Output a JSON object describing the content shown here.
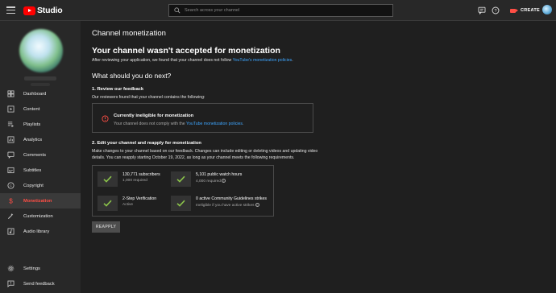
{
  "topbar": {
    "logo_text": "Studio",
    "search_placeholder": "Search across your channel",
    "create_label": "CREATE",
    "icons": [
      "menu-icon",
      "search-icon",
      "message-icon",
      "help-icon",
      "create-camera-icon"
    ]
  },
  "sidebar": {
    "items": [
      {
        "label": "Dashboard",
        "icon": "dashboard-icon"
      },
      {
        "label": "Content",
        "icon": "content-icon"
      },
      {
        "label": "Playlists",
        "icon": "playlists-icon"
      },
      {
        "label": "Analytics",
        "icon": "analytics-icon"
      },
      {
        "label": "Comments",
        "icon": "comments-icon"
      },
      {
        "label": "Subtitles",
        "icon": "subtitles-icon"
      },
      {
        "label": "Copyright",
        "icon": "copyright-icon"
      },
      {
        "label": "Monetization",
        "icon": "monetization-icon"
      },
      {
        "label": "Customization",
        "icon": "customization-icon"
      },
      {
        "label": "Audio library",
        "icon": "audio-library-icon"
      }
    ],
    "bottom_items": [
      {
        "label": "Settings",
        "icon": "settings-icon"
      },
      {
        "label": "Send feedback",
        "icon": "feedback-icon"
      }
    ],
    "active": "Monetization"
  },
  "main": {
    "page_title": "Channel monetization",
    "heading": "Your channel wasn't accepted for monetization",
    "intro_text": "After reviewing your application, we found that your channel does not follow ",
    "intro_link": "YouTube's monetization policies",
    "intro_end": ".",
    "question": "What should you do next?",
    "step1": {
      "title": "1. Review our feedback",
      "text": "Our reviewers found that your channel contains the following:",
      "feedback_title": "Currently ineligible for monetization",
      "feedback_desc": "Your channel does not comply with the ",
      "feedback_link": "YouTube monetization policies",
      "feedback_end": "."
    },
    "step2": {
      "title": "2. Edit your channel and reapply for monetization",
      "text_line1": "Make changes to your channel based on our feedback. Changes can include editing or deleting videos and updating video",
      "text_line2": "details. You can reapply starting October 19, 2022, as long as your channel meets the following requirements."
    },
    "requirements": [
      {
        "title": "130,771 subscribers",
        "sub": "1,000 required",
        "info": false
      },
      {
        "title": "5,101 public watch hours",
        "sub": "4,000 required",
        "info": true
      },
      {
        "title": "2-Step Verification",
        "sub": "Active",
        "info": false
      },
      {
        "title": "0 active Community Guidelines strikes",
        "sub": "Ineligible if you have active strikes",
        "info": true
      }
    ],
    "reapply_label": "REAPPLY"
  },
  "colors": {
    "accent_red": "#ff4e45",
    "link_blue": "#3ea6ff",
    "check_green": "#8bc34a"
  }
}
